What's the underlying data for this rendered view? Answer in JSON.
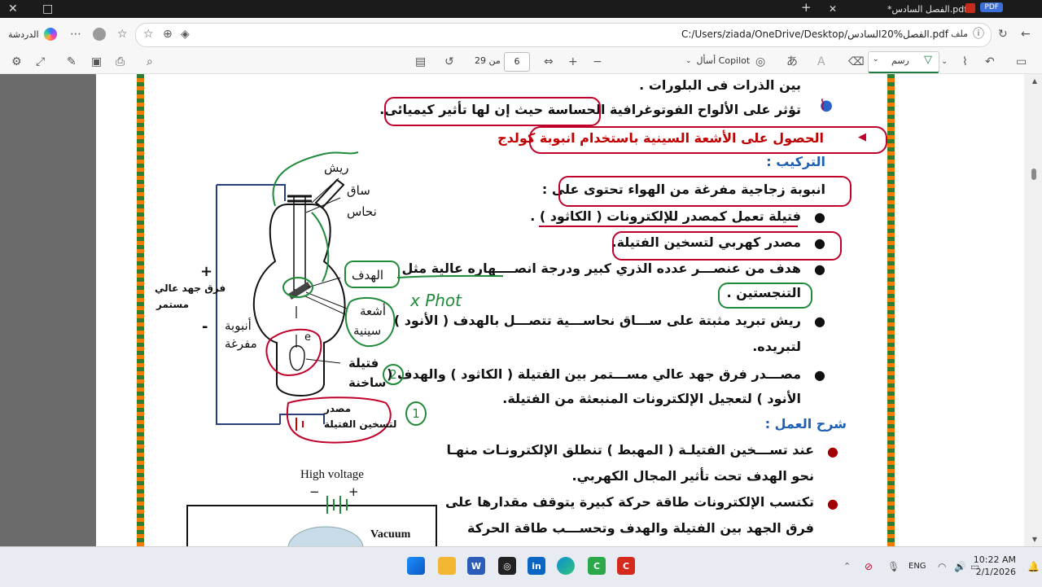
{
  "browser": {
    "tab_title": "*الفصل السادس.pdf",
    "pdf_badge": "PDF",
    "chat_label": "الدردشة",
    "url": "C:/Users/ziada/OneDrive/Desktop/الفصل%20السادس.pdf",
    "file_label": "ملف"
  },
  "toolbar": {
    "draw_label": "رسم",
    "ask_copilot": "أسأل Copilot",
    "page_current": "6",
    "page_of": "من 29"
  },
  "document": {
    "lines": [
      "بين الذرات فى البلورات .",
      "تؤثر على الألواح الفوتوغرافية الحساسة حيث إن لها تأثير كيميائى.",
      "الحصول على الأشعة السينية باستخدام انبوبة كولدج",
      "التركيب :",
      "انبوبة زجاجية مفرغة من الهواء تحتوى على :",
      "فتيلة تعمل كمصدر للإلكترونات ( الكاثود ) .",
      "مصدر كهربي لتسخين الفتيلة.",
      "هدف من عنصـــر عدده الذري كبير ودرجة انصــــهاره عالية مثل",
      "التنجستين .",
      "ريش تبريد مثبتة على ســـاق نحاســـية تتصـــل بالهدف ( الأنود )",
      "لتبريده.",
      "مصـــدر فرق جهد عالي مســـتمر بين الفتيلة ( الكاثود ) والهدف (",
      "الأنود ) لتعجيل الإلكترونات المنبعثة من الفتيلة.",
      "شرح العمل :",
      "عند تســـخين الفتيلـة ( المهبط ) تنطلق الإلكترونـات منهـا",
      "نحو الهدف تحت تأثير المجال الكهربي.",
      "تكتسب الإلكترونات طاقة حركة كبيرة يتوقف مقدارها على",
      "فرق الجهد بين الفتيلة والهدف وتحســـب طاقة الحركة"
    ],
    "diagram": {
      "feather": "ريش",
      "stem": "ساق",
      "copper": "نحاس",
      "target": "الهدف",
      "xrays": [
        "أشعة",
        "سينية"
      ],
      "tube": [
        "أنبوبة",
        "مفرغة"
      ],
      "filament": [
        "فتيلة",
        "ساخنة"
      ],
      "heater_source": [
        "مصدر",
        "لتسخين الفتيلة"
      ],
      "voltage": [
        "فرق جهد عالي",
        "مستمر"
      ],
      "plus": "+",
      "minus": "-",
      "electron": "e",
      "high_voltage": "High voltage",
      "vacuum": "Vacuum",
      "hv_minus": "−",
      "hv_plus": "+",
      "handwriting_xphot": "x Phot",
      "circle_1": "1",
      "circle_2": "2"
    }
  },
  "taskbar": {
    "lang": "ENG",
    "time": "10:22 AM",
    "date": "2/1/2026"
  },
  "colors": {
    "annotation_green": "#1f8a3a",
    "annotation_red": "#c0002a",
    "heading_red": "#c00000",
    "heading_blue": "#1f5fb4"
  }
}
